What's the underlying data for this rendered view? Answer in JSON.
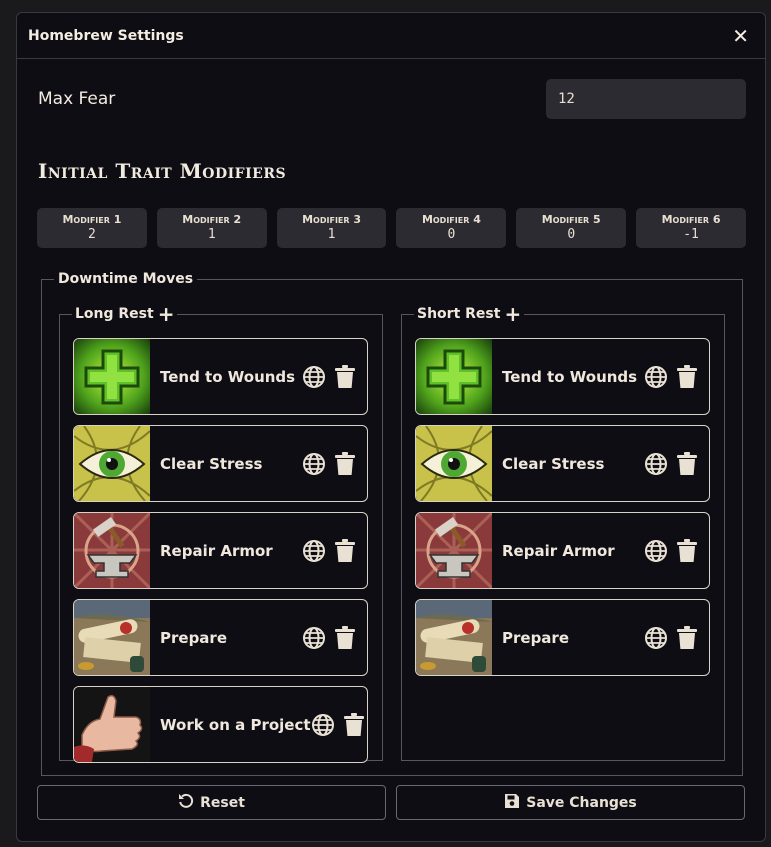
{
  "window": {
    "title": "Homebrew Settings",
    "close_label": "✕"
  },
  "max_fear": {
    "label": "Max Fear",
    "value": "12"
  },
  "trait_modifiers": {
    "title": "Initial Trait Modifiers",
    "items": [
      {
        "label": "Modifier 1",
        "value": "2"
      },
      {
        "label": "Modifier 2",
        "value": "1"
      },
      {
        "label": "Modifier 3",
        "value": "1"
      },
      {
        "label": "Modifier 4",
        "value": "0"
      },
      {
        "label": "Modifier 5",
        "value": "0"
      },
      {
        "label": "Modifier 6",
        "value": "-1"
      }
    ]
  },
  "downtime": {
    "title": "Downtime Moves",
    "long_rest": {
      "title": "Long Rest",
      "moves": [
        {
          "name": "Tend to Wounds",
          "icon": "green-cross"
        },
        {
          "name": "Clear Stress",
          "icon": "eye"
        },
        {
          "name": "Repair Armor",
          "icon": "anvil-hammer"
        },
        {
          "name": "Prepare",
          "icon": "scrolls"
        },
        {
          "name": "Work on a Project",
          "icon": "thumbs-up"
        }
      ]
    },
    "short_rest": {
      "title": "Short Rest",
      "moves": [
        {
          "name": "Tend to Wounds",
          "icon": "green-cross"
        },
        {
          "name": "Clear Stress",
          "icon": "eye"
        },
        {
          "name": "Repair Armor",
          "icon": "anvil-hammer"
        },
        {
          "name": "Prepare",
          "icon": "scrolls"
        }
      ]
    }
  },
  "buttons": {
    "reset": "Reset",
    "save": "Save Changes"
  },
  "colors": {
    "background": "#0e0d14",
    "field": "#2d2b32",
    "text": "#efe6d8",
    "border": "#58565f"
  }
}
